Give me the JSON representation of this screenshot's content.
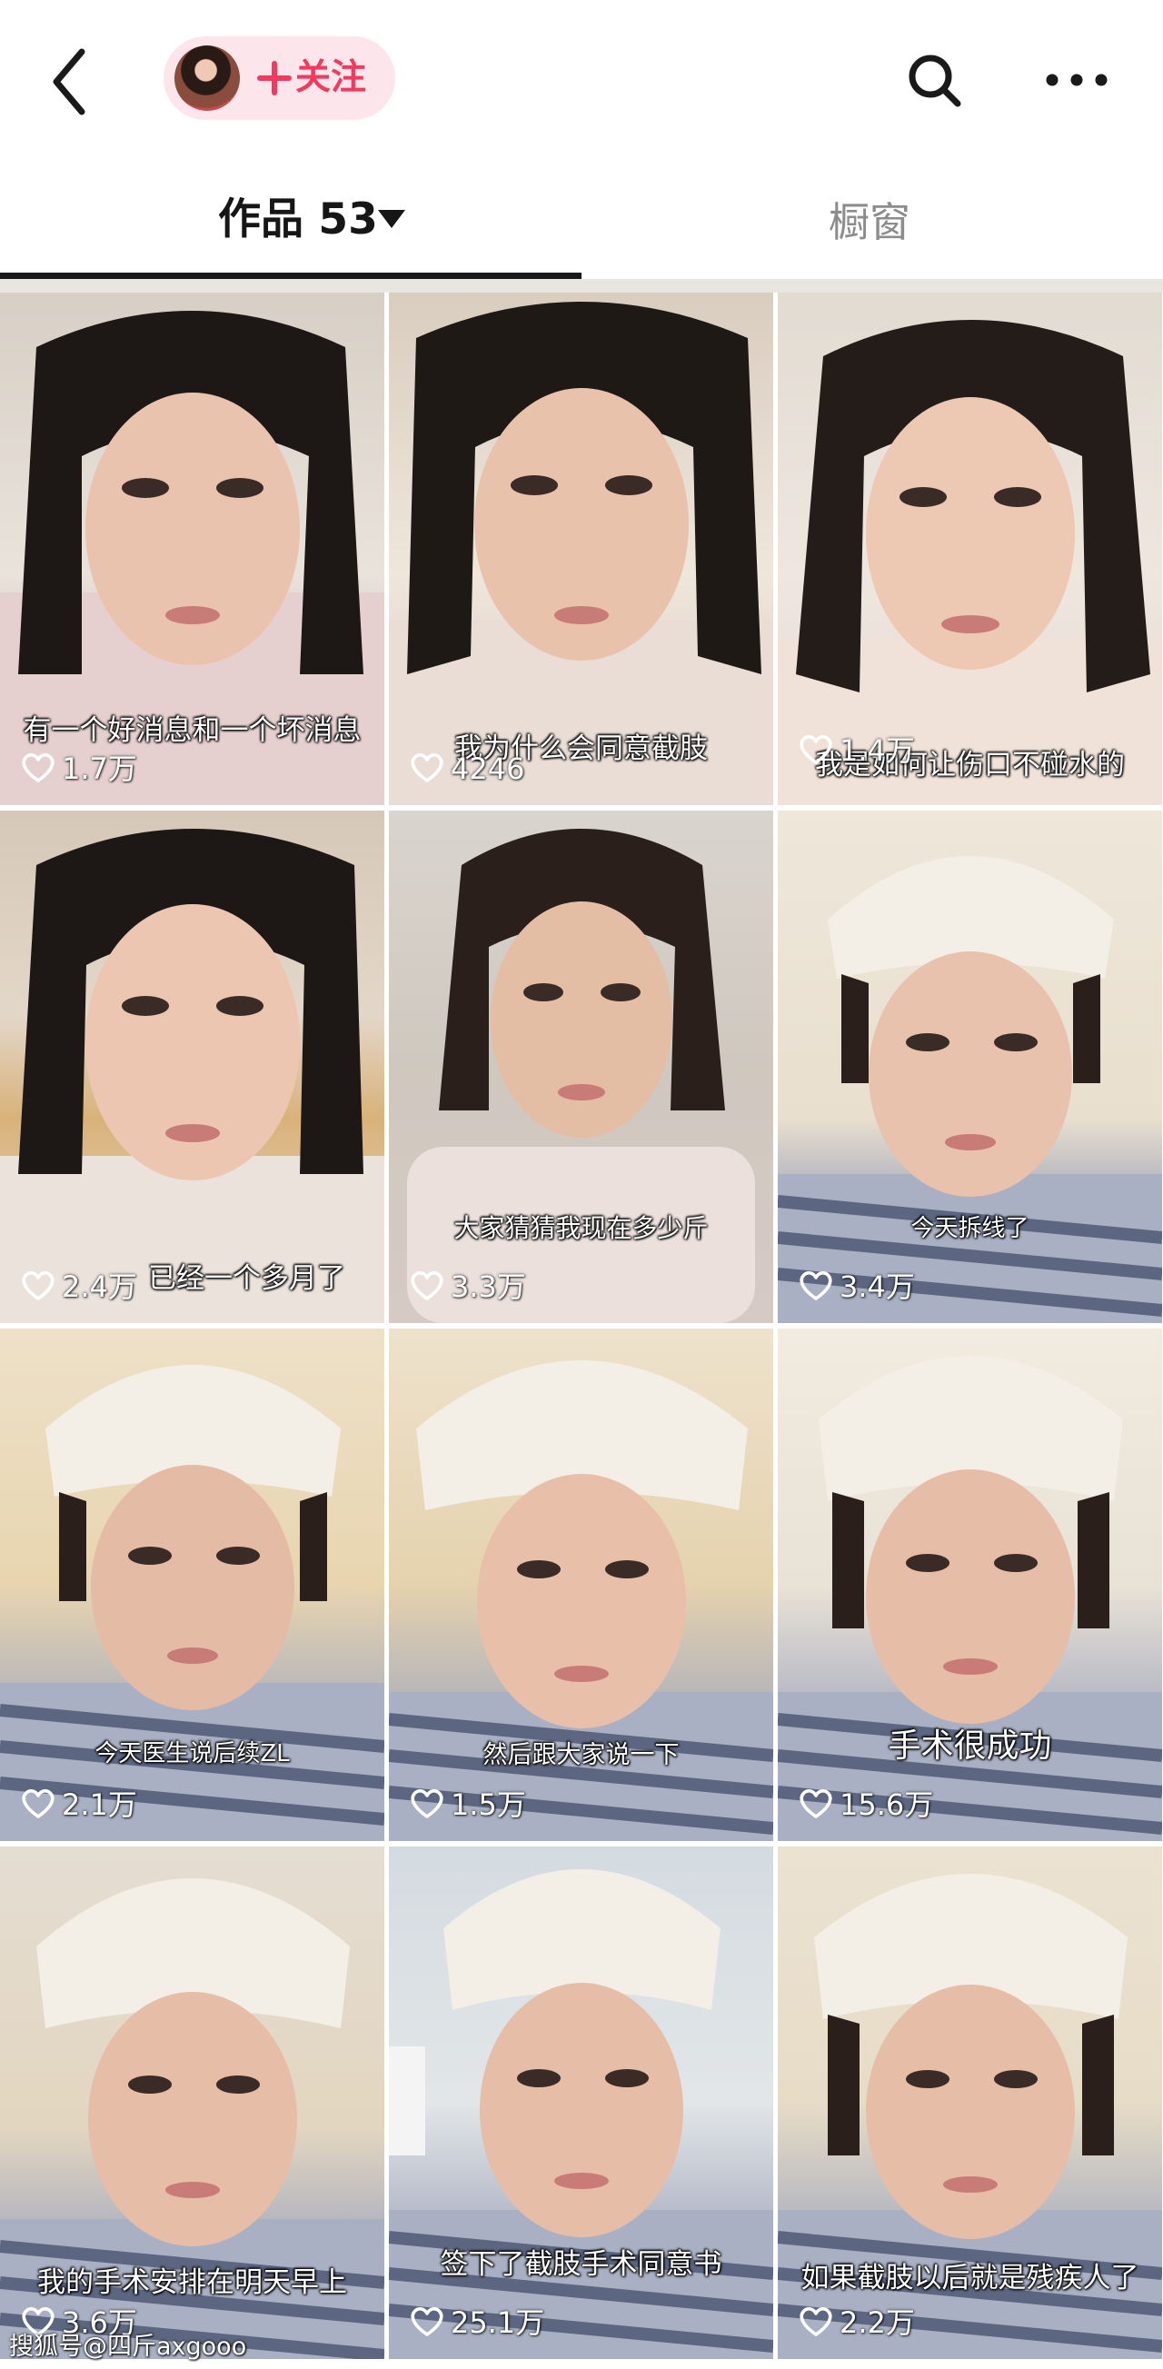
{
  "header": {
    "follow_label": "关注",
    "icons": {
      "back": "chevron-left-icon",
      "search": "search-icon",
      "more": "more-horizontal-icon",
      "plus": "plus-icon"
    },
    "accent_color": "#f03b5e"
  },
  "tabs": {
    "works_label": "作品 53",
    "shop_label": "橱窗"
  },
  "videos": [
    {
      "caption": "有一个好消息和一个坏消息",
      "likes": "1.7万"
    },
    {
      "caption": "我为什么会同意截肢",
      "likes": "4246"
    },
    {
      "caption": "我是如何让伤口不碰水的",
      "likes": "1.4万"
    },
    {
      "caption": "已经一个多月了",
      "likes": "2.4万"
    },
    {
      "caption": "大家猜猜我现在多少斤",
      "likes": "3.3万"
    },
    {
      "caption": "今天拆线了",
      "likes": "3.4万"
    },
    {
      "caption": "今天医生说后续ZL",
      "likes": "2.1万"
    },
    {
      "caption": "然后跟大家说一下",
      "likes": "1.5万"
    },
    {
      "caption": "手术很成功",
      "likes": "15.6万"
    },
    {
      "caption": "我的手术安排在明天早上",
      "likes": "3.6万"
    },
    {
      "caption": "签下了截肢手术同意书",
      "likes": "25.1万"
    },
    {
      "caption": "如果截肢以后就是残疾人了",
      "likes": "2.2万"
    }
  ],
  "watermark": "搜狐号@四斤axgooo"
}
